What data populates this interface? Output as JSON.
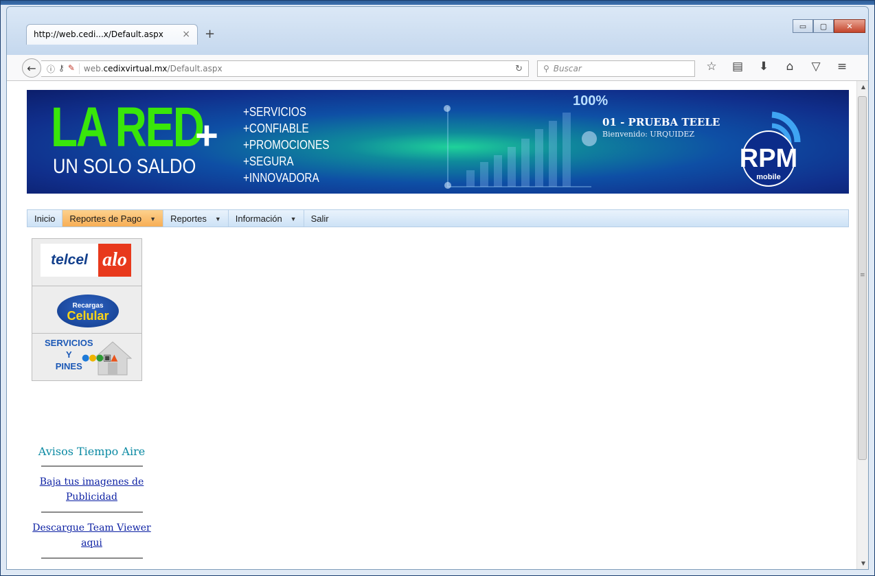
{
  "browser": {
    "tab_title": "http://web.cedi...x/Default.aspx",
    "tab_close": "×",
    "new_tab": "+",
    "url_prefix": "web.",
    "url_domain": "cedixvirtual.mx",
    "url_path": "/Default.aspx",
    "search_placeholder": "Buscar",
    "window_controls": {
      "minimize": "▭",
      "maximize": "▢",
      "close": "✕"
    }
  },
  "banner": {
    "main": "LA RED",
    "plus": "+",
    "sub": "UN SOLO SALDO",
    "list": [
      "+SERVICIOS",
      "+CONFIABLE",
      "+PROMOCIONES",
      "+SEGURA",
      "+INNOVADORA"
    ],
    "percent": "100%",
    "user_name": "01 - PRUEBA TEELE",
    "welcome": "Bienvenido: URQUIDEZ",
    "logo_text": "RPM",
    "logo_sub": "mobile"
  },
  "menu": [
    {
      "label": "Inicio",
      "dropdown": false
    },
    {
      "label": "Reportes de Pago",
      "dropdown": true
    },
    {
      "label": "Reportes",
      "dropdown": true
    },
    {
      "label": "Información",
      "dropdown": true
    },
    {
      "label": "Salir",
      "dropdown": false
    }
  ],
  "side": {
    "telcel": "telcel",
    "alo": "alo",
    "recargas_top": "Recargas",
    "recargas_main": "Celular",
    "servicios_lines": [
      "SERVICIOS",
      "Y",
      "PINES"
    ],
    "avisos": "Avisos Tiempo Aire",
    "links": [
      "Baja tus imagenes de Publicidad",
      "Descargue Team Viewer aqui"
    ]
  },
  "colors": {
    "menu_active": "#f7ae55",
    "banner_green": "#39e60a",
    "link": "#0b1fa3",
    "avisos": "#0b8aa3"
  },
  "icons": [
    "back-arrow-icon",
    "info-icon",
    "key-icon",
    "broken-lock-icon",
    "reload-icon",
    "search-icon",
    "bookmark-star-icon",
    "reading-list-icon",
    "download-icon",
    "home-icon",
    "pocket-icon",
    "hamburger-menu-icon"
  ]
}
